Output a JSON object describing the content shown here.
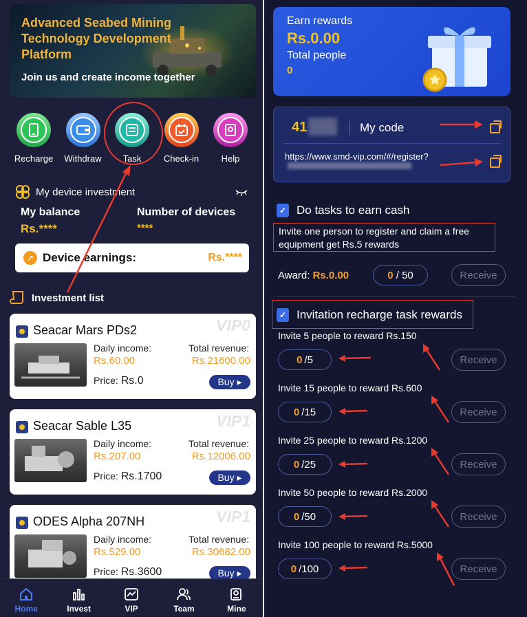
{
  "banner": {
    "title": "Advanced Seabed Mining Technology Development Platform",
    "subtitle": "Join us and create income together"
  },
  "quick_actions": [
    {
      "label": "Recharge",
      "icon": "phone-icon",
      "color": "#2fc45a"
    },
    {
      "label": "Withdraw",
      "icon": "wallet-icon",
      "color": "#3a8ee8"
    },
    {
      "label": "Task",
      "icon": "task-list-icon",
      "color": "#22b8a8"
    },
    {
      "label": "Check-in",
      "icon": "calendar-icon",
      "color": "#f0592a"
    },
    {
      "label": "Help",
      "icon": "help-icon",
      "color": "#d63dbf"
    }
  ],
  "device_investment": {
    "title": "My device investment",
    "balance_label": "My balance",
    "balance_value": "Rs.****",
    "devices_label": "Number of devices",
    "devices_value": "****",
    "earnings_label": "Device earnings:",
    "earnings_value": "Rs.****"
  },
  "investment_list": {
    "title": "Investment list",
    "daily_label": "Daily income:",
    "total_label": "Total revenue:",
    "price_label": "Price:",
    "buy_label": "Buy ▸",
    "items": [
      {
        "name": "Seacar Mars PDs2",
        "vip": "VIP0",
        "daily": "Rs.60.00",
        "total": "Rs.21600.00",
        "price": "Rs.0"
      },
      {
        "name": "Seacar Sable L35",
        "vip": "VIP1",
        "daily": "Rs.207.00",
        "total": "Rs.12006.00",
        "price": "Rs.1700"
      },
      {
        "name": "ODES Alpha 207NH",
        "vip": "VIP1",
        "daily": "Rs.529.00",
        "total": "Rs.30682.00",
        "price": "Rs.3600"
      }
    ]
  },
  "tabbar": [
    {
      "label": "Home",
      "icon": "home-icon",
      "active": true
    },
    {
      "label": "Invest",
      "icon": "bar-chart-icon",
      "active": false
    },
    {
      "label": "VIP",
      "icon": "trend-icon",
      "active": false
    },
    {
      "label": "Team",
      "icon": "team-icon",
      "active": false
    },
    {
      "label": "Mine",
      "icon": "profile-icon",
      "active": false
    }
  ],
  "rewards": {
    "earn_label": "Earn rewards",
    "earn_value": "Rs.0.00",
    "people_label": "Total people",
    "people_value": "0"
  },
  "code": {
    "code_prefix": "41",
    "my_code_label": "My code",
    "url": "https://www.smd-vip.com/#/register?"
  },
  "tasks": {
    "title": "Do tasks to earn cash",
    "description": "Invite one person to register and claim a free equipment get Rs.5 rewards",
    "award_label": "Award:",
    "award_value": "Rs.0.00",
    "progress_current": "0",
    "progress_sep": " / ",
    "progress_total": "50",
    "receive_label": "Receive"
  },
  "invitation": {
    "title": "Invitation recharge task rewards",
    "receive_label": "Receive",
    "items": [
      {
        "label": "Invite 5 people to reward Rs.150",
        "current": "0",
        "total": "/5"
      },
      {
        "label": "Invite 15 people to reward Rs.600",
        "current": "0",
        "total": "/15"
      },
      {
        "label": "Invite 25 people to reward Rs.1200",
        "current": "0",
        "total": "/25"
      },
      {
        "label": "Invite 50 people to reward Rs.2000",
        "current": "0",
        "total": "/50"
      },
      {
        "label": "Invite 100 people to reward Rs.5000",
        "current": "0",
        "total": "/100"
      }
    ]
  },
  "colors": {
    "accent_orange": "#f2a030",
    "accent_yellow": "#f2c022",
    "annotation_red": "#e63a2e",
    "primary_blue": "#2a5be0"
  }
}
